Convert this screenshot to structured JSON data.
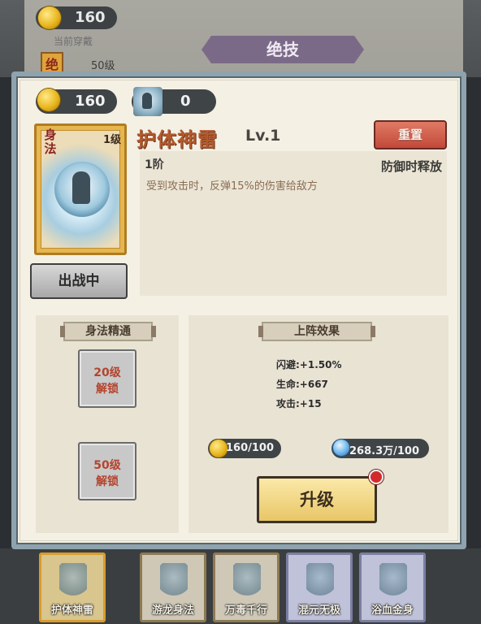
{
  "background": {
    "coins": "160",
    "subtitle": "当前穿戴",
    "badge": "绝",
    "level": "50级",
    "ribbon": "绝技",
    "skill_cards": [
      "护体神雷",
      "游龙身法",
      "万毒千行",
      "混元无极",
      "浴血金身"
    ]
  },
  "currency": {
    "coins": "160",
    "skill_scrolls": "0"
  },
  "skill": {
    "card_type": "身法",
    "card_level": "1级",
    "name": "护体神雷",
    "level": "Lv.1",
    "reset_label": "重置",
    "tier": "1阶",
    "trigger": "防御时释放",
    "description": "受到攻击时，反弹15%的伤害给敌方",
    "deploy_label": "出战中"
  },
  "mastery": {
    "title": "身法精通",
    "slots": [
      {
        "level": "20级",
        "status": "解锁"
      },
      {
        "level": "50级",
        "status": "解锁"
      }
    ]
  },
  "deploy_effect": {
    "title": "上阵效果",
    "stats": [
      "闪避:+1.50%",
      "生命:+667",
      "攻击:+15"
    ]
  },
  "upgrade": {
    "coin_cost": "160/100",
    "gem_cost": "268.3万/100",
    "button_label": "升级"
  },
  "colors": {
    "accent": "#b35a2e",
    "reset_button": "#c2493a",
    "upgrade_button": "#e8c667",
    "dialog_border": "#8ea3ad"
  }
}
